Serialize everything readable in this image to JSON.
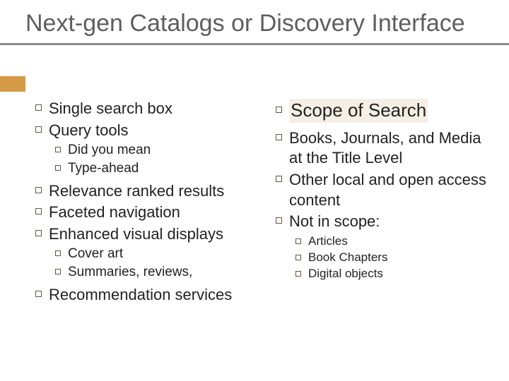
{
  "title": "Next-gen Catalogs or Discovery Interface",
  "left": {
    "b1": "Single search box",
    "b2": "Query tools",
    "sub1": "Did you mean",
    "sub2": "Type-ahead",
    "b3": "Relevance ranked results",
    "b4": "Faceted navigation",
    "b5": "Enhanced visual displays",
    "sub3": "Cover art",
    "sub4": "Summaries, reviews,",
    "b6": "Recommendation services"
  },
  "right": {
    "h": "Scope of Search",
    "r1": "Books, Journals, and Media at the Title Level",
    "r2": "Other local and open access content",
    "r3": "Not in scope:",
    "s1": "Articles",
    "s2": "Book Chapters",
    "s3": "Digital objects"
  }
}
